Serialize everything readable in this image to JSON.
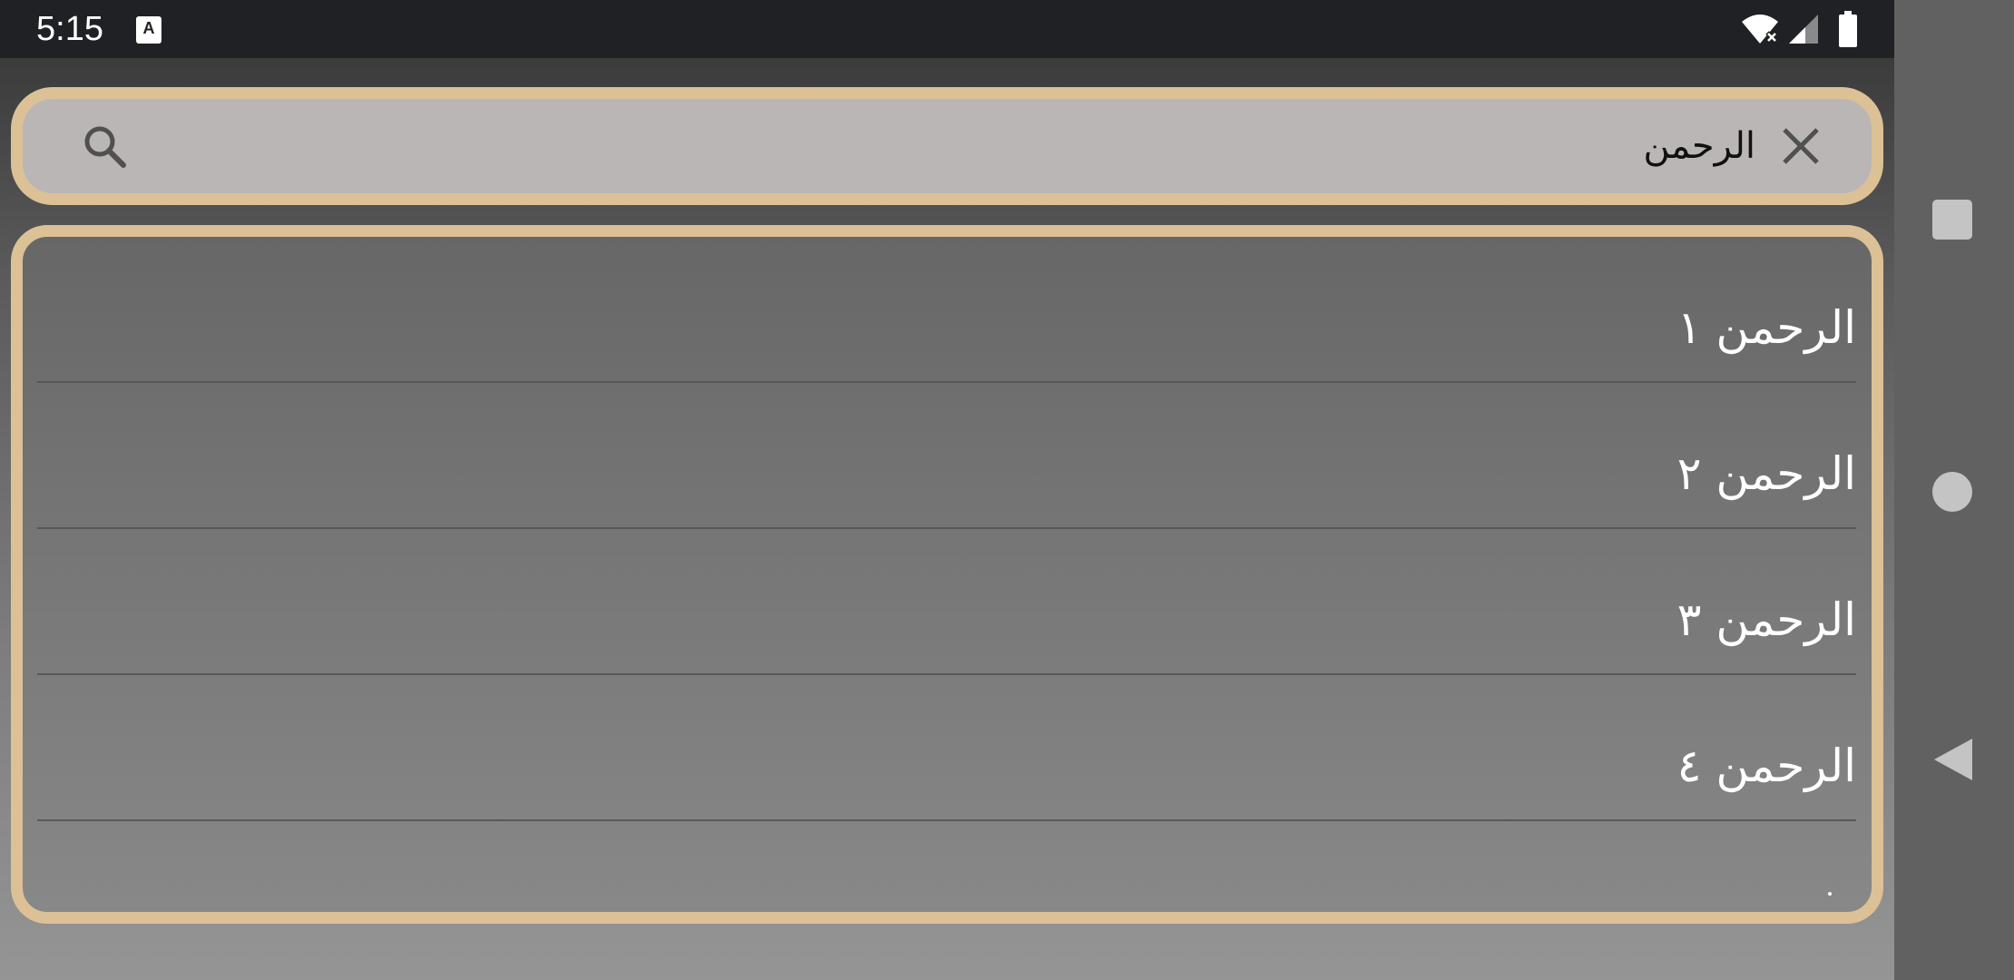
{
  "status_bar": {
    "time": "5:15",
    "notification_icon": "A",
    "icons": [
      "wifi-icon",
      "signal-icon",
      "battery-icon"
    ]
  },
  "search": {
    "query": "الرحمن",
    "icon": "search-icon",
    "clear_icon": "close-icon"
  },
  "results": [
    {
      "label": "الرحمن ١"
    },
    {
      "label": "الرحمن ٢"
    },
    {
      "label": "الرحمن ٣"
    },
    {
      "label": "الرحمن ٤"
    }
  ],
  "nav_bar": {
    "buttons": [
      "recents-icon",
      "home-icon",
      "back-icon"
    ]
  },
  "colors": {
    "accent_border": "#dcc196",
    "search_background": "#bab6b5",
    "status_bar_background": "#202124",
    "nav_bar_background": "#616161",
    "result_text": "#ffffff"
  }
}
